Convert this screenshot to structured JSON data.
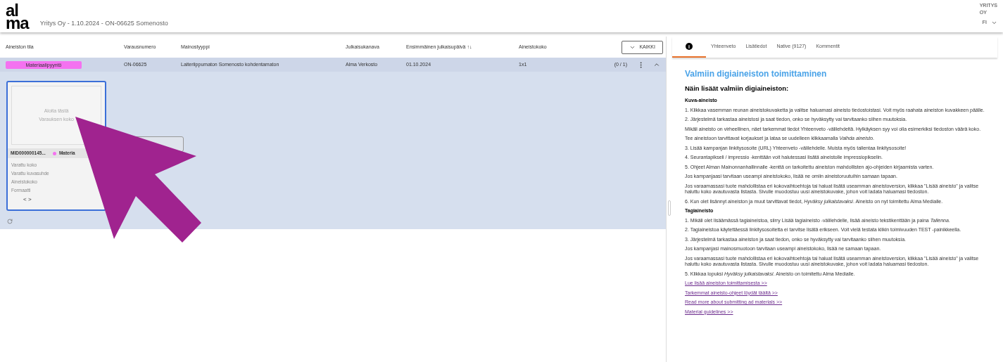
{
  "header": {
    "logo_top": "al",
    "logo_bottom": "ma",
    "title": "Yritys Oy - 1.10.2024 - ON-06625 Somenosto",
    "company_line1": "YRITYS",
    "company_line2": "OY",
    "language": "FI"
  },
  "table": {
    "columns": [
      "Aineiston tila",
      "Varausnumero",
      "Mainostyyppi",
      "Julkaisukanava",
      "Ensimmäinen julkaisupäivä ↑↓",
      "Aineistokoko"
    ],
    "filter_button": "KAIKKI",
    "rows": [
      {
        "status": "Materiaalipyyntö",
        "booking": "ON-06625",
        "ad_type": "Laiteriippumaton Somenosto kohdentamaton",
        "channel": "Alma Verkosto",
        "date": "01.10.2024",
        "size": "1x1",
        "count": "(0 / 1)",
        "expanded": true
      }
    ]
  },
  "material_card": {
    "selected": true,
    "drop_line1": "Aloita tästä",
    "drop_line2": "Varauksen koko",
    "id": "MID000000145...",
    "chip": "Materia",
    "fields": [
      "Varattu koko",
      "Varattu kuvasuhde",
      "Aineistokoko",
      "Formaatti"
    ],
    "nav": "< >"
  },
  "tabs": [
    {
      "label": "i",
      "kind": "icon",
      "selected": true
    },
    {
      "label": "Yhteenveto",
      "kind": "text",
      "selected": false
    },
    {
      "label": "Lisätiedot",
      "kind": "text",
      "selected": false
    },
    {
      "label": "Native (9127)",
      "kind": "text",
      "selected": false
    },
    {
      "label": "Kommentit",
      "kind": "text",
      "selected": false
    }
  ],
  "info": {
    "title": "Valmiin digiaineiston toimittaminen",
    "subtitle": "Näin lisäät valmiin digiaineiston:",
    "blocks": [
      {
        "kind": "heading",
        "text": "Kuva-aineisto"
      },
      {
        "kind": "p",
        "text": "1. Klikkaa vasemman reunan aineistokuvaketta ja valitse haluamasi aineisto tiedostoistasi. Voit myös raahata aineiston kuvakkeen päälle."
      },
      {
        "kind": "p",
        "text": "2. Järjestelmä tarkastaa aineistosi ja saat tiedon, onko se hyväksytty vai tarvitaanko siihen muutoksia."
      },
      {
        "kind": "p",
        "text": "Mikäli aineisto on virheellinen, näet tarkemmat tiedot Yhteenveto -välilehdeltä. Hylkäyksen syy voi olla esimerkiksi tiedoston väärä koko."
      },
      {
        "kind": "p",
        "text": "Tee aineistoon tarvittavat korjaukset ja lataa se uudelleen klikkaamalla *Vaihda aineisto*."
      },
      {
        "kind": "p",
        "text": "3. Lisää kampanjan linkitysosoite (URL) Yhteenveto -välilehdelle. Muista myös tallentaa linkitysosoite!"
      },
      {
        "kind": "p",
        "text": "4. Seurantapikseli / impressio -kenttään voit halutessasi lisätä aineistolle impressiopikselin."
      },
      {
        "kind": "p",
        "text": "5. Ohjeet Alman Mainonnanhallinnalle -kenttä on tarkoitettu aineiston mahdollisten ajo-ohjeiden kirjaamista varten."
      },
      {
        "kind": "p",
        "text": "Jos kampanjaasi tarvitaan useampi aineistokoko, lisää ne omiin aineistoruutuihin samaan tapaan."
      },
      {
        "kind": "p",
        "text": "Jos varaamassasi tuote mahdollistaa eri kokovaihtoehtoja tai haluat lisätä useamman aineistoversion, klikkaa \"Lisää aineisto\" ja valitse haluttu koko avautuvasta listasta. Sivulle muodostuu uusi aineistokuvake, johon voit ladata haluamasi tiedoston."
      },
      {
        "kind": "p",
        "text": "6. Kun olet lisännyt aineiston ja muut tarvittavat tiedot, *Hyväksy julkaistavaksi*. Aineisto on nyt toimitettu Alma Medialle."
      },
      {
        "kind": "heading",
        "text": "Tagiaineisto"
      },
      {
        "kind": "p",
        "text": "1. Mikäli olet lisäämässä tagiaineistoa, siirry Lisää tagiaineisto -välilehdelle, lisää aineisto tekstikenttään ja paina *Tallenna*."
      },
      {
        "kind": "p",
        "text": "2. Tagiaineistoa käytettäessä linkitysosoitetta ei tarvitse lisätä erikseen. Voit vielä testata klikin toimivuuden TEST -painikkeella."
      },
      {
        "kind": "p",
        "text": "3. Järjestelmä tarkastaa aineiston ja saat tiedon, onko se hyväksytty vai tarvitaanko siihen muutoksia."
      },
      {
        "kind": "p",
        "text": "Jos kampanjasi mainosmuotoon tarvitaan useampi aineistokoko, lisää ne samaan tapaan."
      },
      {
        "kind": "p",
        "text": "Jos varaamassasi tuote mahdollistaa eri kokovaihtoehtoja tai haluat lisätä useamman aineistoversion, klikkaa \"Lisää aineisto\" ja valitse haluttu koko avautuvasta listasta. Sivulle muodostuu uusi aineistokuvake, johon voit ladata haluamasi tiedoston."
      },
      {
        "kind": "p",
        "text": "5. Klikkaa lopuksi *Hyväksy julkaistavaksi*. Aineisto on toimitettu Alma Medialle."
      },
      {
        "kind": "link",
        "text": "Lue lisää aineiston toimittamisesta >>"
      },
      {
        "kind": "link",
        "text": "Tarkemmat aineisto-ohjeet löydät täältä >>"
      },
      {
        "kind": "link",
        "text": "Read more about submitting ad materials >>"
      },
      {
        "kind": "link",
        "text": "Material guidelines >>"
      }
    ]
  }
}
